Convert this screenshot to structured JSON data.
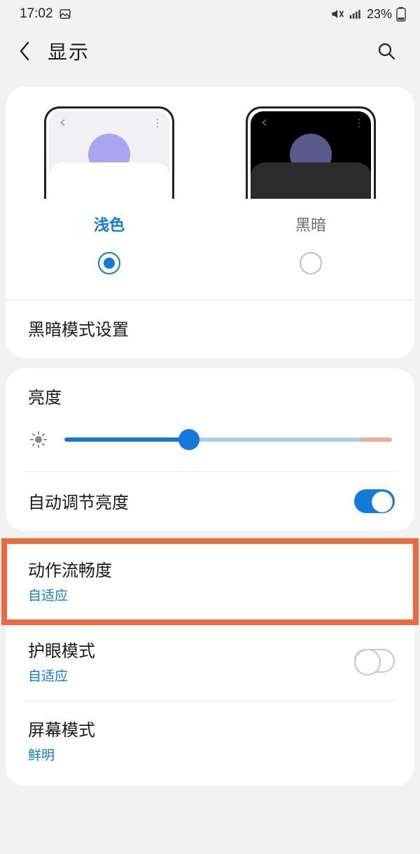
{
  "status": {
    "time": "17:02",
    "battery_pct": "23%",
    "icons": {
      "picture": "picture-icon",
      "mute": "mute-vibrate-icon",
      "signal": "signal-icon",
      "battery": "battery-icon"
    }
  },
  "header": {
    "title": "显示"
  },
  "theme": {
    "light_label": "浅色",
    "dark_label": "黑暗",
    "selected": "light",
    "dark_mode_settings": "黑暗模式设置"
  },
  "brightness": {
    "title": "亮度",
    "value_pct": 38,
    "auto_label": "自动调节亮度",
    "auto_on": true
  },
  "rows": {
    "motion": {
      "title": "动作流畅度",
      "sub": "自适应"
    },
    "eye": {
      "title": "护眼模式",
      "sub": "自适应",
      "on": false
    },
    "screen": {
      "title": "屏幕模式",
      "sub": "鲜明"
    }
  },
  "colors": {
    "accent": "#1279de",
    "highlight": "#ec6a3a"
  }
}
